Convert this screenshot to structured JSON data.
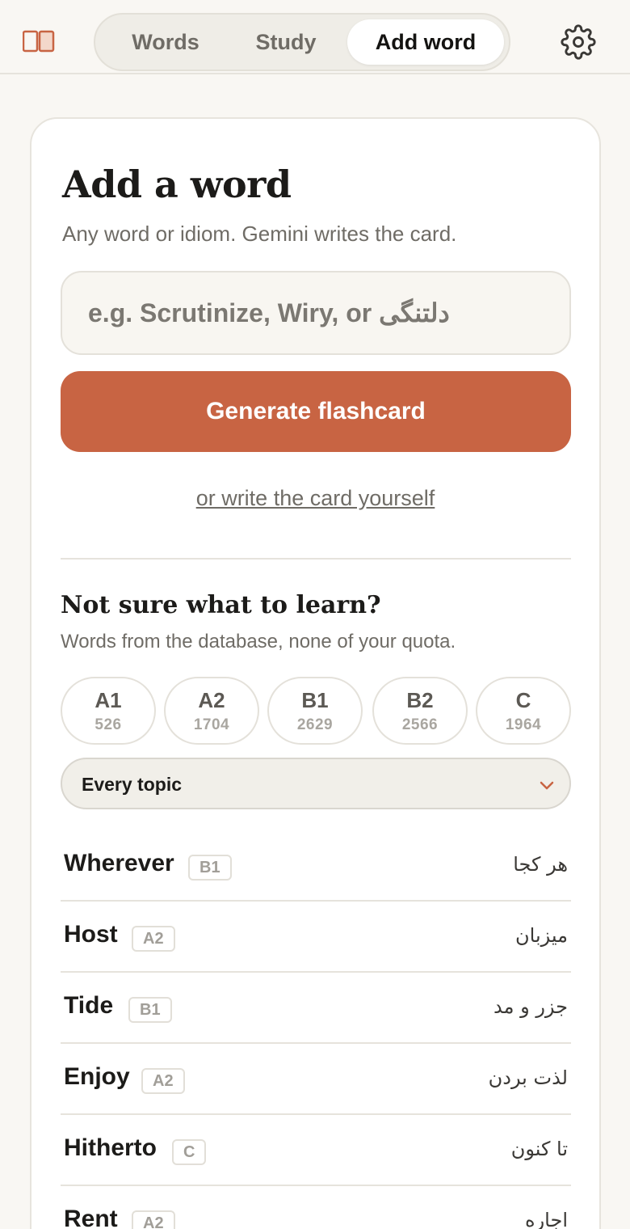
{
  "nav": {
    "tabs": [
      {
        "label": "Words",
        "active": false
      },
      {
        "label": "Study",
        "active": false
      },
      {
        "label": "Add word",
        "active": true
      }
    ],
    "logo_icon": "book-icon",
    "settings_icon": "gear-icon"
  },
  "add": {
    "title": "Add a word",
    "subtitle": "Any word or idiom. Gemini writes the card.",
    "input_placeholder": "e.g. Scrutinize, Wiry, or دلتنگی",
    "input_value": "",
    "generate_label": "Generate flashcard",
    "manual_link": "or write the card yourself"
  },
  "suggest": {
    "title": "Not sure what to learn?",
    "subtitle": "Words from the database, none of your quota.",
    "levels": [
      {
        "code": "A1",
        "count": "526"
      },
      {
        "code": "A2",
        "count": "1704"
      },
      {
        "code": "B1",
        "count": "2629"
      },
      {
        "code": "B2",
        "count": "2566"
      },
      {
        "code": "C",
        "count": "1964"
      }
    ],
    "topic_select": "Every topic",
    "words": [
      {
        "word": "Wherever",
        "level": "B1",
        "translation": "هر کجا"
      },
      {
        "word": "Host",
        "level": "A2",
        "translation": "میزبان"
      },
      {
        "word": "Tide",
        "level": "B1",
        "translation": "جزر و مد"
      },
      {
        "word": "Enjoy",
        "level": "A2",
        "translation": "لذت بردن"
      },
      {
        "word": "Hitherto",
        "level": "C",
        "translation": "تا کنون"
      },
      {
        "word": "Rent",
        "level": "A2",
        "translation": "اجاره"
      }
    ]
  },
  "colors": {
    "accent": "#c86443",
    "background": "#f9f7f3",
    "card": "#ffffff"
  }
}
